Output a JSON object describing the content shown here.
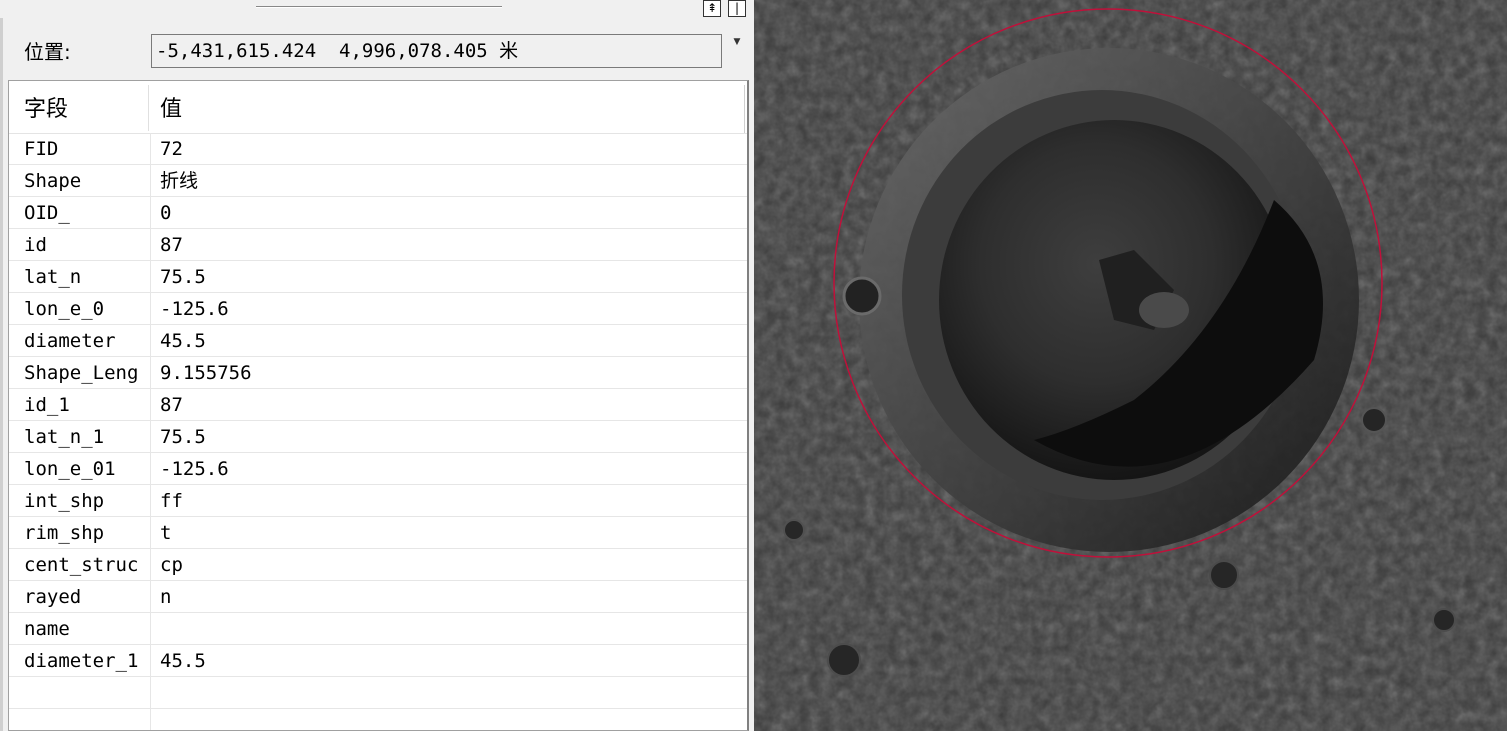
{
  "toolbar": {
    "pin_icon": "pin-icon",
    "close_icon": "close-icon"
  },
  "location": {
    "label": "位置:",
    "value": "-5,431,615.424  4,996,078.405 米"
  },
  "table": {
    "headers": {
      "field": "字段",
      "value": "值"
    },
    "rows": [
      {
        "field": "FID",
        "value": "72"
      },
      {
        "field": "Shape",
        "value": "折线"
      },
      {
        "field": "OID_",
        "value": "0"
      },
      {
        "field": "id",
        "value": "87"
      },
      {
        "field": "lat_n",
        "value": "75.5"
      },
      {
        "field": "lon_e_0",
        "value": "-125.6"
      },
      {
        "field": "diameter",
        "value": "45.5"
      },
      {
        "field": "Shape_Leng",
        "value": "9.155756"
      },
      {
        "field": "id_1",
        "value": "87"
      },
      {
        "field": "lat_n_1",
        "value": "75.5"
      },
      {
        "field": "lon_e_01",
        "value": "-125.6"
      },
      {
        "field": "int_shp",
        "value": "ff"
      },
      {
        "field": "rim_shp",
        "value": "t"
      },
      {
        "field": "cent_struc",
        "value": "cp"
      },
      {
        "field": "rayed",
        "value": "n"
      },
      {
        "field": "name",
        "value": ""
      },
      {
        "field": "diameter_1",
        "value": "45.5"
      },
      {
        "field": "",
        "value": ""
      },
      {
        "field": "",
        "value": ""
      }
    ]
  },
  "map": {
    "outline_color": "#c0103a",
    "surface_color": "#3b3b3b"
  }
}
